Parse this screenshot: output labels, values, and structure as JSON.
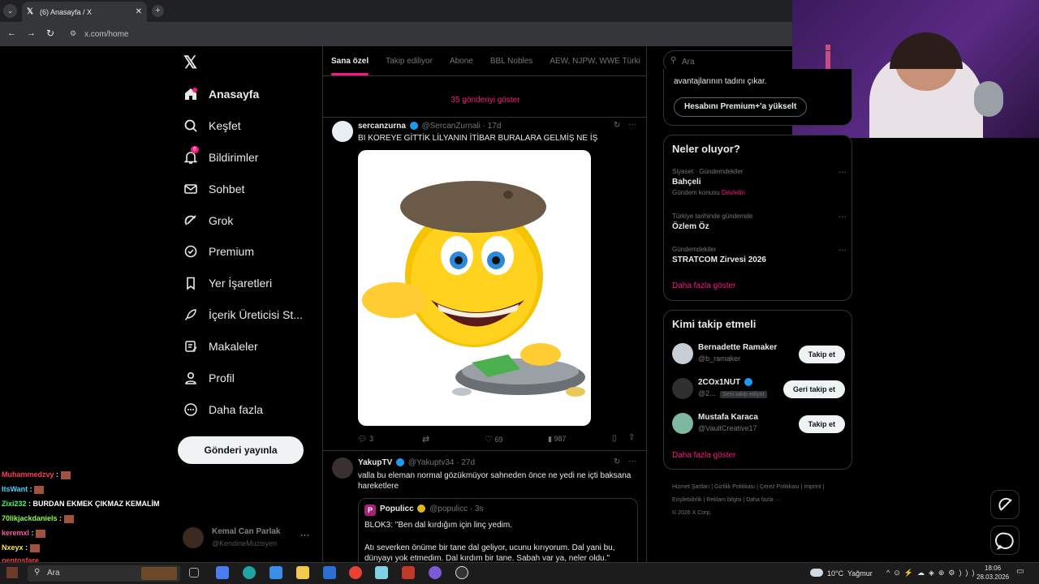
{
  "browser": {
    "tab_title": "(6) Anasayfa / X",
    "url": "x.com/home"
  },
  "nav": {
    "items": [
      {
        "label": "Anasayfa",
        "icon": "home-icon"
      },
      {
        "label": "Keşfet",
        "icon": "search-icon"
      },
      {
        "label": "Bildirimler",
        "icon": "bell-icon",
        "badge": "6"
      },
      {
        "label": "Sohbet",
        "icon": "mail-icon"
      },
      {
        "label": "Grok",
        "icon": "grok-icon"
      },
      {
        "label": "Premium",
        "icon": "premium-icon"
      },
      {
        "label": "Yer İşaretleri",
        "icon": "bookmark-icon"
      },
      {
        "label": "İçerik Üreticisi St...",
        "icon": "rocket-icon"
      },
      {
        "label": "Makaleler",
        "icon": "article-icon"
      },
      {
        "label": "Profil",
        "icon": "person-icon"
      },
      {
        "label": "Daha fazla",
        "icon": "more-circle-icon"
      }
    ],
    "post_button": "Gönderi yayınla",
    "account_name": "Kemal Can Parlak",
    "account_handle": "@KendineMuzisyen"
  },
  "timeline": {
    "tabs": [
      "Sana özel",
      "Takip ediliyor",
      "Abone",
      "BBL Nobles",
      "AEW, NJPW, WWE Türki"
    ],
    "show_more": "35 gönderiyi göster",
    "tweet1": {
      "name": "sercanzurna",
      "handle": "@SercanZurnali",
      "time": "· 17d",
      "text": "BI KOREYE GİTTİK LİLYANIN İTİBAR BURALARA GELMİŞ NE İŞ",
      "replies": "3",
      "likes": "69",
      "views": "987"
    },
    "tweet2": {
      "name": "YakupTV",
      "handle": "@Yakuptv34",
      "time": "· 27d",
      "text": "valla bu eleman normal gözükmüyor sahneden önce ne yedi ne içti baksana hareketlere",
      "quote_name": "Populicc",
      "quote_handle": "@populicc",
      "quote_time": "· 3s",
      "quote_line1": "BLOK3: \"Ben dal kırdığım için linç yedim.",
      "quote_line2": "Atı severken önüme bir tane dal geliyor, ucunu kırıyorum. Dal yani bu, dünyayı yok etmedim. Dal kırdım bir tane. Sabah var ya, neler oldu.\""
    }
  },
  "right": {
    "search_placeholder": "Ara",
    "premium_text": "avantajlarının tadını çıkar.",
    "premium_button": "Hesabını Premium+'a yükselt",
    "trends_title": "Neler oluyor?",
    "trends": [
      {
        "meta": "Siyaset · Gündemdekiler",
        "name": "Bahçeli",
        "extra_label": "Gündem konusu",
        "extra_link": "Devletin"
      },
      {
        "meta": "Türkiye tarihinde gündemde",
        "name": "Özlem Öz"
      },
      {
        "meta": "Gündemdekiler",
        "name": "STRATCOM Zirvesi 2026"
      }
    ],
    "trends_more": "Daha fazla göster",
    "follow_title": "Kimi takip etmeli",
    "follow": [
      {
        "name": "Bernadette Ramaker",
        "handle": "@b_ramaker",
        "button": "Takip et"
      },
      {
        "name": "2COx1NUT",
        "handle": "@2...",
        "tag": "Seni takip ediyor",
        "button": "Geri takip et"
      },
      {
        "name": "Mustafa Karaca",
        "handle": "@VaultCreative17",
        "button": "Takip et"
      }
    ],
    "follow_more": "Daha fazla göster",
    "footer_links": [
      "Hizmet Şartları",
      "Gizlilik Politikası",
      "Çerez Politikası",
      "Imprint",
      "Erişilebilirlik",
      "Reklam bilgisi",
      "Daha fazla ···"
    ],
    "copyright": "© 2026 X Corp."
  },
  "chat": [
    {
      "user": "Muhammedzvy",
      "color": "#ff3b5c",
      "msg": ""
    },
    {
      "user": "ItsWant",
      "color": "#3bd4ff",
      "msg": ""
    },
    {
      "user": "Zixi232",
      "color": "#3bff6b",
      "msg": "BURDAN EKMEK ÇIKMAZ KEMALİM"
    },
    {
      "user": "70likjackdaniels",
      "color": "#8cff3b",
      "msg": ""
    },
    {
      "user": "keremxl",
      "color": "#ff5ca8",
      "msg": ""
    },
    {
      "user": "Nxeyx",
      "color": "#ffe53b",
      "msg": ""
    },
    {
      "user": "pentosfare",
      "color": "#ff3b3b",
      "msg": ""
    }
  ],
  "taskbar": {
    "search": "Ara",
    "weather": "10°C  Yağmur",
    "time": "18:06",
    "date": "28.03.2026"
  }
}
